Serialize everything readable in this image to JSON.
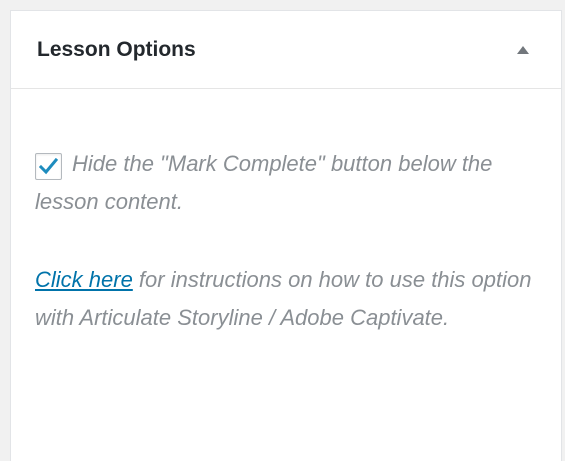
{
  "metabox": {
    "title": "Lesson Options"
  },
  "option": {
    "checked": true,
    "label": "Hide the \"Mark Complete\" button below the lesson content."
  },
  "info": {
    "link_text": "Click here",
    "text": " for instructions on how to use this option with Articulate Storyline / Adobe Captivate."
  },
  "colors": {
    "accent": "#0073aa",
    "muted_text": "#8a8f94",
    "title_text": "#23282d"
  },
  "icons": {
    "toggle": "triangle-up-icon",
    "check": "checkmark-icon"
  }
}
